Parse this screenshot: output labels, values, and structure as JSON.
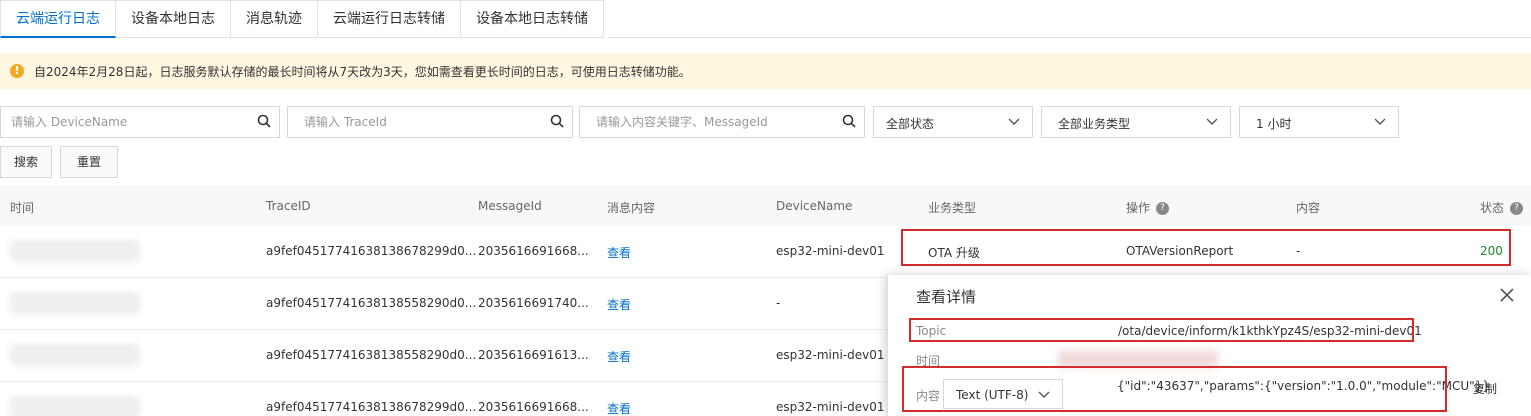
{
  "tabs": [
    "云端运行日志",
    "设备本地日志",
    "消息轨迹",
    "云端运行日志转储",
    "设备本地日志转储"
  ],
  "notice": "自2024年2月28日起，日志服务默认存储的最长时间将从7天改为3天，您如需查看更长时间的日志，可使用日志转储功能。",
  "filters": {
    "device_placeholder": "请输入 DeviceName",
    "trace_placeholder": "请输入 TraceId",
    "content_placeholder": "请输入内容关键字、MessageId",
    "status": "全部状态",
    "biz": "全部业务类型",
    "time": "1 小时"
  },
  "buttons": {
    "search": "搜索",
    "reset": "重置"
  },
  "columns": [
    "时间",
    "TraceID",
    "MessageId",
    "消息内容",
    "DeviceName",
    "业务类型",
    "操作",
    "内容",
    "状态"
  ],
  "rows": [
    {
      "trace": "a9fef04517741638138678299d0...",
      "msg": "2035616691668...",
      "view": "查看",
      "device": "esp32-mini-dev01",
      "biz": "OTA 升级",
      "op": "OTAVersionReport",
      "content": "-",
      "status": "200"
    },
    {
      "trace": "a9fef04517741638138558290d0...",
      "msg": "2035616691740...",
      "view": "查看",
      "device": "-"
    },
    {
      "trace": "a9fef04517741638138558290d0...",
      "msg": "2035616691613...",
      "view": "查看",
      "device": "esp32-mini-dev01"
    },
    {
      "trace": "a9fef04517741638138678299d0...",
      "msg": "2035616691668...",
      "view": "查看",
      "device": "esp32-mini-dev01"
    }
  ],
  "drawer": {
    "title": "查看详情",
    "topic_label": "Topic",
    "topic_value": "/ota/device/inform/k1kthkYpz4S/esp32-mini-dev01",
    "time_label": "时间",
    "content_label": "内容",
    "encoding": "Text (UTF-8)",
    "content_value": "{\"id\":\"43637\",\"params\":{\"version\":\"1.0.0\",\"module\":\"MCU\"}}",
    "copy": "复制"
  },
  "colors": {
    "accent": "#0070cc",
    "success": "#1f8a2f",
    "highlight": "#d52b2b",
    "notice_bg": "#fff7e0"
  }
}
